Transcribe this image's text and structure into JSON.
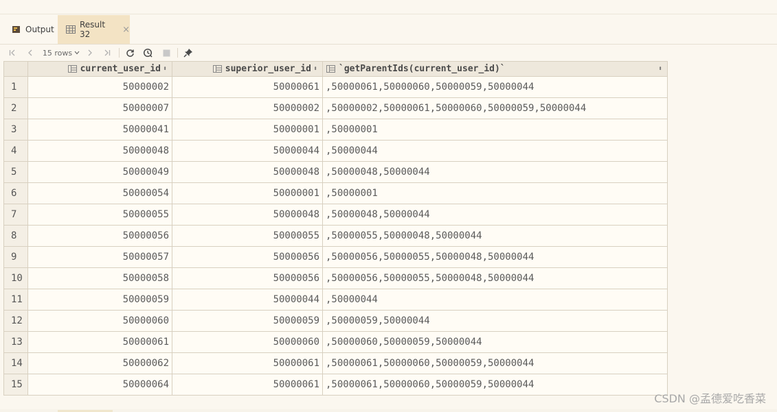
{
  "tabs": {
    "output_label": "Output",
    "result_label": "Result 32",
    "close": "×"
  },
  "toolbar": {
    "rows_label": "15 rows",
    "icons": [
      "first-page-icon",
      "prev-page-icon",
      "next-page-icon",
      "last-page-icon",
      "refresh-icon",
      "history-icon",
      "stop-icon",
      "pin-icon"
    ]
  },
  "table": {
    "columns": [
      "current_user_id",
      "superior_user_id",
      "`getParentIds(current_user_id)`"
    ],
    "rows": [
      [
        "1",
        "50000002",
        "50000061",
        ",50000061,50000060,50000059,50000044"
      ],
      [
        "2",
        "50000007",
        "50000002",
        ",50000002,50000061,50000060,50000059,50000044"
      ],
      [
        "3",
        "50000041",
        "50000001",
        ",50000001"
      ],
      [
        "4",
        "50000048",
        "50000044",
        ",50000044"
      ],
      [
        "5",
        "50000049",
        "50000048",
        ",50000048,50000044"
      ],
      [
        "6",
        "50000054",
        "50000001",
        ",50000001"
      ],
      [
        "7",
        "50000055",
        "50000048",
        ",50000048,50000044"
      ],
      [
        "8",
        "50000056",
        "50000055",
        ",50000055,50000048,50000044"
      ],
      [
        "9",
        "50000057",
        "50000056",
        ",50000056,50000055,50000048,50000044"
      ],
      [
        "10",
        "50000058",
        "50000056",
        ",50000056,50000055,50000048,50000044"
      ],
      [
        "11",
        "50000059",
        "50000044",
        ",50000044"
      ],
      [
        "12",
        "50000060",
        "50000059",
        ",50000059,50000044"
      ],
      [
        "13",
        "50000061",
        "50000060",
        ",50000060,50000059,50000044"
      ],
      [
        "14",
        "50000062",
        "50000061",
        ",50000061,50000060,50000059,50000044"
      ],
      [
        "15",
        "50000064",
        "50000061",
        ",50000061,50000060,50000059,50000044"
      ]
    ]
  },
  "watermark": "CSDN @孟德爱吃香菜",
  "colors": {
    "background": "#fbf7ef",
    "active_tab": "#f3e3c4",
    "header_bg": "#eee8dc",
    "grid_line": "#d8d0c0"
  }
}
